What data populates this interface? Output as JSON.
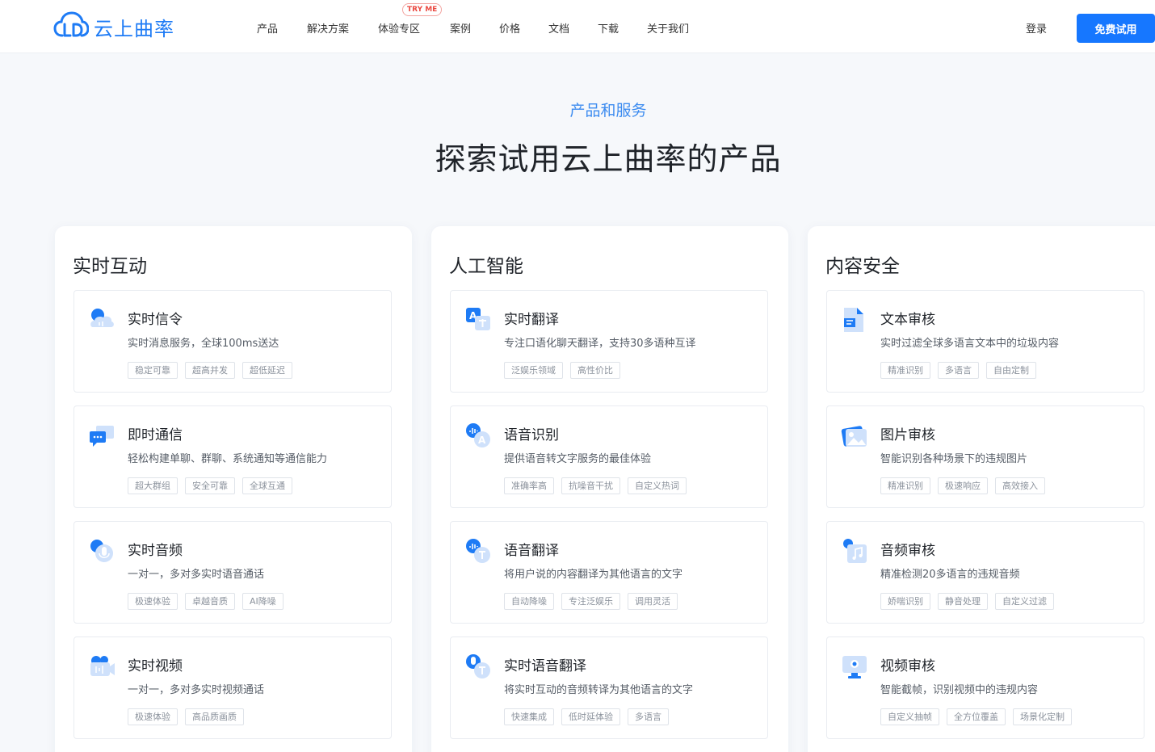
{
  "header": {
    "logo_text": "云上曲率",
    "nav": [
      "产品",
      "解决方案",
      "体验专区",
      "案例",
      "价格",
      "文档",
      "下载",
      "关于我们"
    ],
    "try_badge": "TRY ME",
    "login": "登录",
    "trial_button": "免费试用"
  },
  "hero": {
    "subtitle": "产品和服务",
    "title": "探索试用云上曲率的产品"
  },
  "colors": {
    "accent": "#1677ff",
    "subtitle": "#3d8cf0",
    "badge_red": "#ea4a42"
  },
  "columns": [
    {
      "title": "实时互动",
      "cards": [
        {
          "icon": "cloud-signal-icon",
          "title": "实时信令",
          "desc": "实时消息服务，全球100ms送达",
          "tags": [
            "稳定可靠",
            "超高并发",
            "超低延迟"
          ]
        },
        {
          "icon": "chat-bubble-icon",
          "title": "即时通信",
          "desc": "轻松构建单聊、群聊、系统通知等通信能力",
          "tags": [
            "超大群组",
            "安全可靠",
            "全球互通"
          ]
        },
        {
          "icon": "microphone-icon",
          "title": "实时音频",
          "desc": "一对一，多对多实时语音通话",
          "tags": [
            "极速体验",
            "卓越音质",
            "AI降噪"
          ]
        },
        {
          "icon": "video-camera-icon",
          "title": "实时视频",
          "desc": "一对一，多对多实时视频通话",
          "tags": [
            "极速体验",
            "高品质画质"
          ]
        }
      ]
    },
    {
      "title": "人工智能",
      "cards": [
        {
          "icon": "translate-icon",
          "title": "实时翻译",
          "desc": "专注口语化聊天翻译，支持30多语种互译",
          "tags": [
            "泛娱乐领域",
            "高性价比"
          ]
        },
        {
          "icon": "speech-recognition-icon",
          "title": "语音识别",
          "desc": "提供语音转文字服务的最佳体验",
          "tags": [
            "准确率高",
            "抗噪音干扰",
            "自定义热词"
          ]
        },
        {
          "icon": "voice-translate-icon",
          "title": "语音翻译",
          "desc": "将用户说的内容翻译为其他语言的文字",
          "tags": [
            "自动降噪",
            "专注泛娱乐",
            "调用灵活"
          ]
        },
        {
          "icon": "realtime-voice-translate-icon",
          "title": "实时语音翻译",
          "desc": "将实时互动的音频转译为其他语言的文字",
          "tags": [
            "快速集成",
            "低时延体验",
            "多语言"
          ]
        }
      ]
    },
    {
      "title": "内容安全",
      "cards": [
        {
          "icon": "document-icon",
          "title": "文本审核",
          "desc": "实时过滤全球多语言文本中的垃圾内容",
          "tags": [
            "精准识别",
            "多语言",
            "自由定制"
          ]
        },
        {
          "icon": "image-icon",
          "title": "图片审核",
          "desc": "智能识别各种场景下的违规图片",
          "tags": [
            "精准识别",
            "极速响应",
            "高效接入"
          ]
        },
        {
          "icon": "music-note-icon",
          "title": "音频审核",
          "desc": "精准检测20多语言的违规音频",
          "tags": [
            "娇喘识别",
            "静音处理",
            "自定义过滤"
          ]
        },
        {
          "icon": "monitor-icon",
          "title": "视频审核",
          "desc": "智能截帧，识别视频中的违规内容",
          "tags": [
            "自定义抽帧",
            "全方位覆盖",
            "场景化定制"
          ]
        }
      ]
    }
  ]
}
